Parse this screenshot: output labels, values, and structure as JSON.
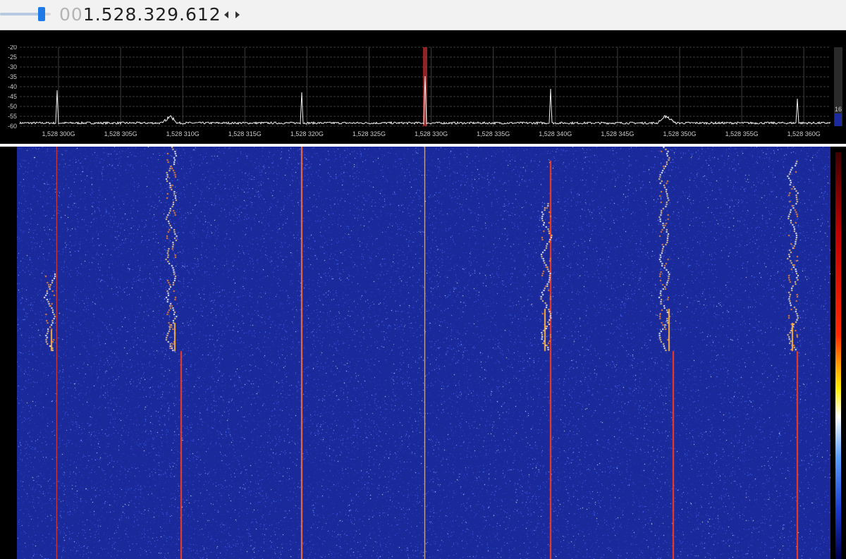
{
  "toolbar": {
    "freq_dim": "00",
    "freq_main": "1.528.329.612",
    "volume_level": 0.78
  },
  "spectrum": {
    "db_labels": [
      "-20",
      "-25",
      "-30",
      "-35",
      "-40",
      "-45",
      "-50",
      "-55",
      "-60"
    ],
    "freq_labels": [
      "1,528 300G",
      "1,528 305G",
      "1,528 310G",
      "1,528 315G",
      "1,528 320G",
      "1,528 325G",
      "1,528 330G",
      "1,528 335G",
      "1,528 340G",
      "1,528 345G",
      "1,528 350G",
      "1,528 355G",
      "1,528 360G"
    ],
    "gain_label": "16",
    "colors": {
      "grid": "#3c3c3c",
      "trace": "#f0f0f0",
      "marker": "#c03030"
    }
  },
  "waterfall": {
    "colors": {
      "background": "#1a2a9a",
      "noise": "#4a6aff",
      "carrier": "#ff3a1a"
    }
  }
}
